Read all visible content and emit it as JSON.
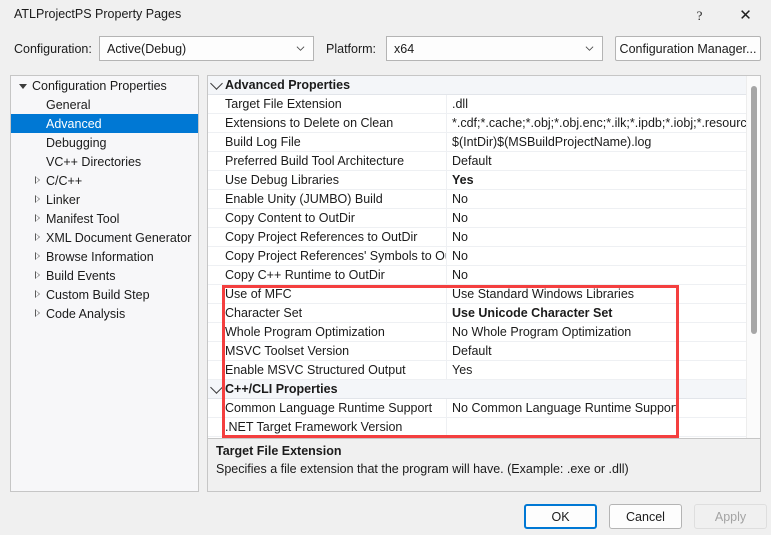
{
  "window": {
    "title": "ATLProjectPS Property Pages",
    "help_icon": "?",
    "close_icon": "✕"
  },
  "config_bar": {
    "configuration_label": "Configuration:",
    "configuration_value": "Active(Debug)",
    "platform_label": "Platform:",
    "platform_value": "x64",
    "configuration_manager_label": "Configuration Manager..."
  },
  "tree": {
    "items": [
      {
        "label": "Configuration Properties",
        "indent": 0,
        "expander": "open",
        "selected": false
      },
      {
        "label": "General",
        "indent": 1,
        "expander": "none",
        "selected": false
      },
      {
        "label": "Advanced",
        "indent": 1,
        "expander": "none",
        "selected": true
      },
      {
        "label": "Debugging",
        "indent": 1,
        "expander": "none",
        "selected": false
      },
      {
        "label": "VC++ Directories",
        "indent": 1,
        "expander": "none",
        "selected": false
      },
      {
        "label": "C/C++",
        "indent": 1,
        "expander": "closed",
        "selected": false
      },
      {
        "label": "Linker",
        "indent": 1,
        "expander": "closed",
        "selected": false
      },
      {
        "label": "Manifest Tool",
        "indent": 1,
        "expander": "closed",
        "selected": false
      },
      {
        "label": "XML Document Generator",
        "indent": 1,
        "expander": "closed",
        "selected": false
      },
      {
        "label": "Browse Information",
        "indent": 1,
        "expander": "closed",
        "selected": false
      },
      {
        "label": "Build Events",
        "indent": 1,
        "expander": "closed",
        "selected": false
      },
      {
        "label": "Custom Build Step",
        "indent": 1,
        "expander": "closed",
        "selected": false
      },
      {
        "label": "Code Analysis",
        "indent": 1,
        "expander": "closed",
        "selected": false
      }
    ]
  },
  "grid": {
    "rows": [
      {
        "category": true,
        "name": "Advanced Properties",
        "value": ""
      },
      {
        "category": false,
        "name": "Target File Extension",
        "value": ".dll",
        "bold": false
      },
      {
        "category": false,
        "name": "Extensions to Delete on Clean",
        "value": "*.cdf;*.cache;*.obj;*.obj.enc;*.ilk;*.ipdb;*.iobj;*.resources;*.t",
        "bold": false
      },
      {
        "category": false,
        "name": "Build Log File",
        "value": "$(IntDir)$(MSBuildProjectName).log",
        "bold": false
      },
      {
        "category": false,
        "name": "Preferred Build Tool Architecture",
        "value": "Default",
        "bold": false
      },
      {
        "category": false,
        "name": "Use Debug Libraries",
        "value": "Yes",
        "bold": true
      },
      {
        "category": false,
        "name": "Enable Unity (JUMBO) Build",
        "value": "No",
        "bold": false
      },
      {
        "category": false,
        "name": "Copy Content to OutDir",
        "value": "No",
        "bold": false
      },
      {
        "category": false,
        "name": "Copy Project References to OutDir",
        "value": "No",
        "bold": false
      },
      {
        "category": false,
        "name": "Copy Project References' Symbols to Ou",
        "value": "No",
        "bold": false
      },
      {
        "category": false,
        "name": "Copy C++ Runtime to OutDir",
        "value": "No",
        "bold": false
      },
      {
        "category": false,
        "name": "Use of MFC",
        "value": "Use Standard Windows Libraries",
        "bold": false
      },
      {
        "category": false,
        "name": "Character Set",
        "value": "Use Unicode Character Set",
        "bold": true
      },
      {
        "category": false,
        "name": "Whole Program Optimization",
        "value": "No Whole Program Optimization",
        "bold": false
      },
      {
        "category": false,
        "name": "MSVC Toolset Version",
        "value": "Default",
        "bold": false
      },
      {
        "category": false,
        "name": "Enable MSVC Structured Output",
        "value": "Yes",
        "bold": false
      },
      {
        "category": true,
        "name": "C++/CLI Properties",
        "value": ""
      },
      {
        "category": false,
        "name": "Common Language Runtime Support",
        "value": "No Common Language Runtime Support",
        "bold": false
      },
      {
        "category": false,
        "name": ".NET Target Framework Version",
        "value": "",
        "bold": false
      }
    ]
  },
  "description": {
    "title": "Target File Extension",
    "body": "Specifies a file extension that the program will have. (Example: .exe or .dll)"
  },
  "footer": {
    "ok_label": "OK",
    "cancel_label": "Cancel",
    "apply_label": "Apply"
  },
  "annotation": {
    "highlight_color": "#f43f3f"
  }
}
